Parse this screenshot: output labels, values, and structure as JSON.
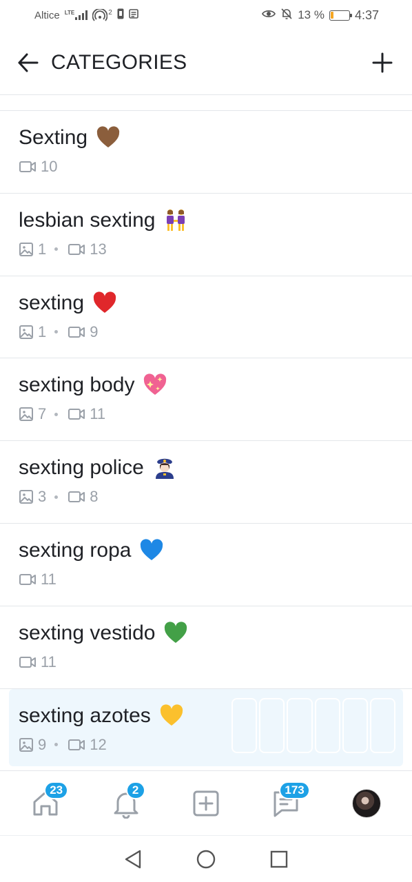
{
  "status_bar": {
    "carrier": "Altice",
    "network": "LTE",
    "hotspot_count": "2",
    "battery_text": "13 %",
    "battery_level": 0.13,
    "time": "4:37"
  },
  "header": {
    "title": "CATEGORIES"
  },
  "categories": [
    {
      "name": "Sexting",
      "emoji": "brown-heart",
      "images": null,
      "videos": "10"
    },
    {
      "name": "lesbian sexting",
      "emoji": "two-women-holding-hands",
      "images": "1",
      "videos": "13"
    },
    {
      "name": "sexting",
      "emoji": "red-heart",
      "images": "1",
      "videos": "9"
    },
    {
      "name": "sexting body",
      "emoji": "sparkling-heart",
      "images": "7",
      "videos": "11"
    },
    {
      "name": "sexting police",
      "emoji": "woman-police-officer",
      "images": "3",
      "videos": "8"
    },
    {
      "name": "sexting ropa",
      "emoji": "blue-heart",
      "images": null,
      "videos": "11"
    },
    {
      "name": "sexting vestido",
      "emoji": "green-heart",
      "images": null,
      "videos": "11"
    },
    {
      "name": "sexting azotes",
      "emoji": "yellow-heart",
      "images": "9",
      "videos": "12"
    }
  ],
  "bottom_nav": {
    "home_badge": "23",
    "notifications_badge": "2",
    "messages_badge": "173"
  },
  "colors": {
    "accent": "#1da1e6",
    "text": "#1f2126",
    "muted": "#9aa0a8",
    "divider": "#e3e6ea",
    "highlight": "#eef7fd",
    "battery": "#f5a623"
  }
}
